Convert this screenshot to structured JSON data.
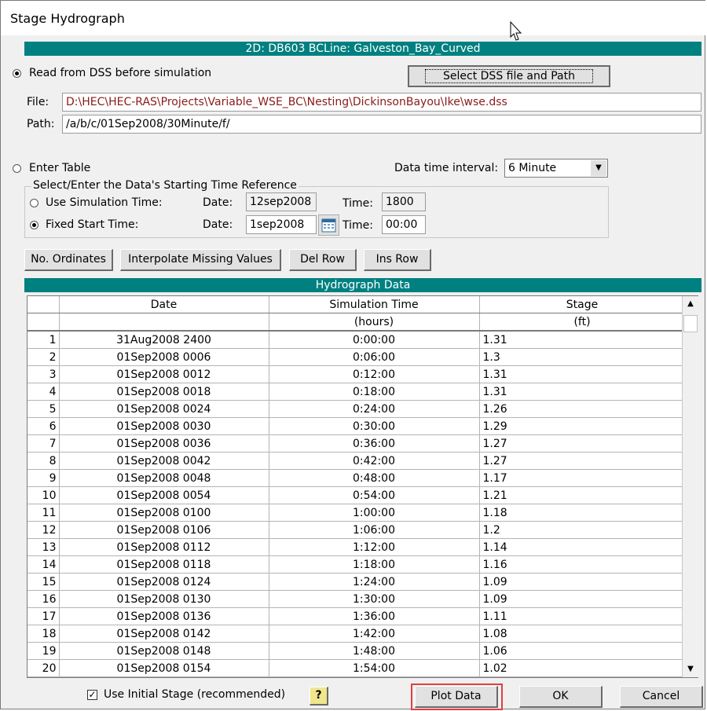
{
  "window": {
    "title": "Stage Hydrograph"
  },
  "banner": {
    "text": "2D: DB603 BCLine: Galveston_Bay_Curved"
  },
  "dss": {
    "radio_label": "Read from DSS before simulation",
    "select_button": "Select DSS file and Path",
    "file_label": "File:",
    "file_value": "D:\\HEC\\HEC-RAS\\Projects\\Variable_WSE_BC\\Nesting\\DickinsonBayou\\Ike\\wse.dss",
    "path_label": "Path:",
    "path_value": "/a/b/c/01Sep2008/30Minute/f/"
  },
  "table_entry": {
    "radio_label": "Enter Table",
    "interval_label": "Data time interval:",
    "interval_value": "6 Minute",
    "group_label": "Select/Enter the Data's Starting Time Reference",
    "sim_time_label": "Use Simulation Time:",
    "sim_date_label": "Date:",
    "sim_date_value": "12sep2008",
    "sim_time_field_label": "Time:",
    "sim_time_value": "1800",
    "fixed_label": "Fixed Start Time:",
    "fixed_date_label": "Date:",
    "fixed_date_value": "1sep2008",
    "fixed_time_label": "Time:",
    "fixed_time_value": "00:00"
  },
  "toolbar": {
    "ordinates": "No. Ordinates",
    "interpolate": "Interpolate Missing Values",
    "del_row": "Del Row",
    "ins_row": "Ins Row"
  },
  "grid": {
    "title": "Hydrograph Data",
    "headers": [
      "Date",
      "Simulation Time",
      "Stage"
    ],
    "units": [
      "",
      "(hours)",
      "(ft)"
    ],
    "rows": [
      [
        "1",
        "31Aug2008 2400",
        "0:00:00",
        "1.31"
      ],
      [
        "2",
        "01Sep2008 0006",
        "0:06:00",
        "1.3"
      ],
      [
        "3",
        "01Sep2008 0012",
        "0:12:00",
        "1.31"
      ],
      [
        "4",
        "01Sep2008 0018",
        "0:18:00",
        "1.31"
      ],
      [
        "5",
        "01Sep2008 0024",
        "0:24:00",
        "1.26"
      ],
      [
        "6",
        "01Sep2008 0030",
        "0:30:00",
        "1.29"
      ],
      [
        "7",
        "01Sep2008 0036",
        "0:36:00",
        "1.27"
      ],
      [
        "8",
        "01Sep2008 0042",
        "0:42:00",
        "1.27"
      ],
      [
        "9",
        "01Sep2008 0048",
        "0:48:00",
        "1.17"
      ],
      [
        "10",
        "01Sep2008 0054",
        "0:54:00",
        "1.21"
      ],
      [
        "11",
        "01Sep2008 0100",
        "1:00:00",
        "1.18"
      ],
      [
        "12",
        "01Sep2008 0106",
        "1:06:00",
        "1.2"
      ],
      [
        "13",
        "01Sep2008 0112",
        "1:12:00",
        "1.14"
      ],
      [
        "14",
        "01Sep2008 0118",
        "1:18:00",
        "1.16"
      ],
      [
        "15",
        "01Sep2008 0124",
        "1:24:00",
        "1.09"
      ],
      [
        "16",
        "01Sep2008 0130",
        "1:30:00",
        "1.09"
      ],
      [
        "17",
        "01Sep2008 0136",
        "1:36:00",
        "1.11"
      ],
      [
        "18",
        "01Sep2008 0142",
        "1:42:00",
        "1.08"
      ],
      [
        "19",
        "01Sep2008 0148",
        "1:48:00",
        "1.06"
      ],
      [
        "20",
        "01Sep2008 0154",
        "1:54:00",
        "1.02"
      ]
    ]
  },
  "footer": {
    "initial_stage_label": "Use Initial Stage (recommended)",
    "initial_stage_checked": "✓",
    "help_icon": "?",
    "plot_data": "Plot Data",
    "ok": "OK",
    "cancel": "Cancel"
  },
  "colors": {
    "accent_teal": "#008080",
    "file_text": "#8b1a1a",
    "highlight": "#e04040"
  }
}
